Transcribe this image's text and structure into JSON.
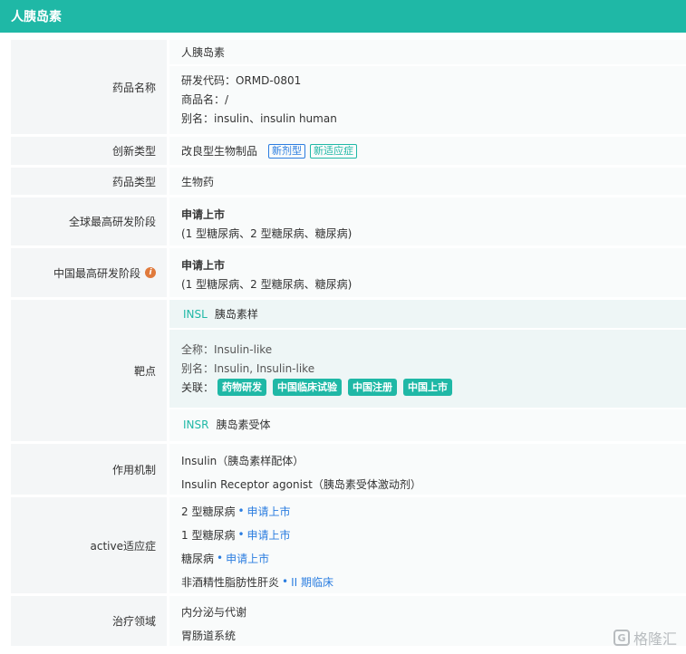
{
  "header": {
    "title": "人胰岛素"
  },
  "rows": {
    "drug_name": {
      "label": "药品名称",
      "name": "人胰岛素",
      "code": "研发代码：ORMD-0801",
      "trade": "商品名：/",
      "alias": "别名：insulin、insulin human"
    },
    "innovation": {
      "label": "创新类型",
      "value": "改良型生物制品",
      "badge1": "新剂型",
      "badge2": "新适应症"
    },
    "drug_type": {
      "label": "药品类型",
      "value": "生物药"
    },
    "global_stage": {
      "label": "全球最高研发阶段",
      "stage": "申请上市",
      "detail": "(1 型糖尿病、2 型糖尿病、糖尿病)"
    },
    "china_stage": {
      "label": "中国最高研发阶段",
      "stage": "申请上市",
      "detail": "(1 型糖尿病、2 型糖尿病、糖尿病)"
    },
    "target": {
      "label": "靶点",
      "t1_code": "INSL",
      "t1_name": "胰岛素样",
      "fullname": "全称：Insulin-like",
      "alias": "别名：Insulin, Insulin-like",
      "related_label": "关联：",
      "related": [
        "药物研发",
        "中国临床试验",
        "中国注册",
        "中国上市"
      ],
      "t2_code": "INSR",
      "t2_name": "胰岛素受体"
    },
    "mechanism": {
      "label": "作用机制",
      "m1": "Insulin（胰岛素样配体）",
      "m2": "Insulin Receptor agonist（胰岛素受体激动剂）"
    },
    "indication": {
      "label": "active适应症",
      "items": [
        {
          "name": "2 型糖尿病",
          "stage": "申请上市"
        },
        {
          "name": "1 型糖尿病",
          "stage": "申请上市"
        },
        {
          "name": "糖尿病",
          "stage": "申请上市"
        },
        {
          "name": "非酒精性脂肪性肝炎",
          "stage": "II 期临床"
        }
      ]
    },
    "therapy": {
      "label": "治疗领域",
      "a1": "内分泌与代谢",
      "a2": "胃肠道系统"
    }
  },
  "watermark": {
    "text": "格隆汇",
    "icon": "G"
  },
  "colors": {
    "accent": "#1fb8a6",
    "link": "#2b7de0",
    "info": "#e07a3c"
  }
}
